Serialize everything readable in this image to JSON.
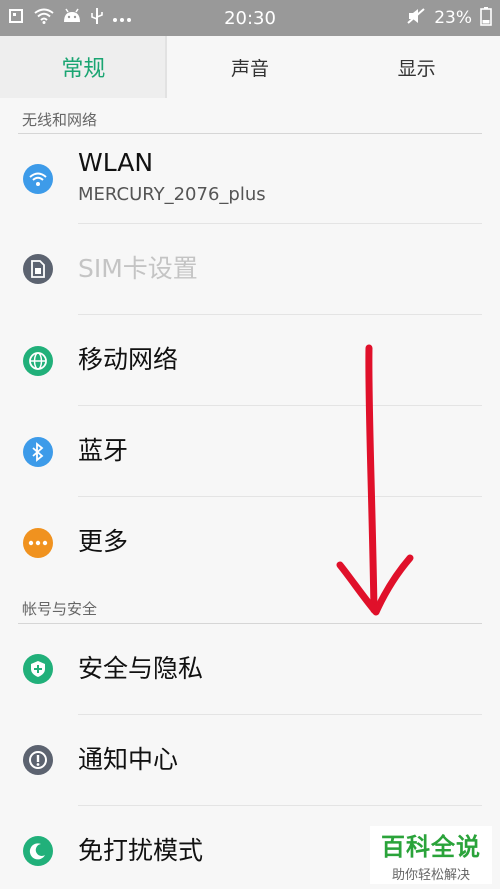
{
  "status_bar": {
    "time": "20:30",
    "battery": "23%"
  },
  "tabs": [
    {
      "label": "常规",
      "active": true
    },
    {
      "label": "声音",
      "active": false
    },
    {
      "label": "显示",
      "active": false
    }
  ],
  "sections": {
    "network": "无线和网络",
    "account": "帐号与安全"
  },
  "rows": [
    {
      "title": "WLAN",
      "subtitle": "MERCURY_2076_plus",
      "icon": "wifi-icon",
      "color": "#3d9be9"
    },
    {
      "title": "SIM卡设置",
      "icon": "sim-card-icon",
      "color": "#c8c8c8"
    },
    {
      "title": "移动网络",
      "icon": "globe-icon",
      "color": "#21b07a"
    },
    {
      "title": "蓝牙",
      "icon": "bluetooth-icon",
      "color": "#3d9be9"
    },
    {
      "title": "更多",
      "icon": "more-icon",
      "color": "#f0921f"
    },
    {
      "title": "安全与隐私",
      "icon": "shield-icon",
      "color": "#21b07a"
    },
    {
      "title": "通知中心",
      "icon": "notification-icon",
      "color": "#5c6370"
    },
    {
      "title": "免打扰模式",
      "icon": "moon-icon",
      "color": "#21b07a"
    }
  ],
  "watermark": {
    "title": "百科全说",
    "subtitle": "助你轻松解决"
  },
  "colors": {
    "accent": "#1aa572",
    "annotation": "#e0102a"
  }
}
